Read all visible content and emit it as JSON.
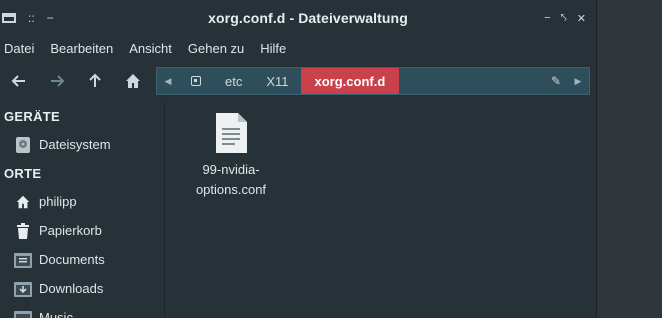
{
  "window": {
    "title": "xorg.conf.d - Dateiverwaltung",
    "left_glyph": "::",
    "minimize": "−",
    "controls": [
      "−",
      "⤣",
      "✕"
    ]
  },
  "menu": [
    "Datei",
    "Bearbeiten",
    "Ansicht",
    "Gehen zu",
    "Hilfe"
  ],
  "toolbar": {
    "back_icon": "arrow-left-icon",
    "forward_icon": "arrow-right-icon",
    "up_icon": "arrow-up-icon",
    "home_icon": "home-icon"
  },
  "path": {
    "crumbs": [
      "etc",
      "X11",
      "xorg.conf.d"
    ],
    "active": "xorg.conf.d",
    "active_color": "#c8414b"
  },
  "sidebar": {
    "devices_header": "GERÄTE",
    "devices": [
      {
        "label": "Dateisystem",
        "icon": "drive-icon"
      }
    ],
    "places_header": "ORTE",
    "places": [
      {
        "label": "philipp",
        "icon": "home-icon"
      },
      {
        "label": "Papierkorb",
        "icon": "trash-icon"
      },
      {
        "label": "Documents",
        "icon": "folder-documents-icon"
      },
      {
        "label": "Downloads",
        "icon": "folder-downloads-icon"
      },
      {
        "label": "Music",
        "icon": "folder-music-icon"
      }
    ]
  },
  "files": [
    {
      "name": "99-nvidia-options.conf",
      "line1": "99-nvidia-",
      "line2": "options.conf",
      "icon": "text-file-icon"
    }
  ]
}
